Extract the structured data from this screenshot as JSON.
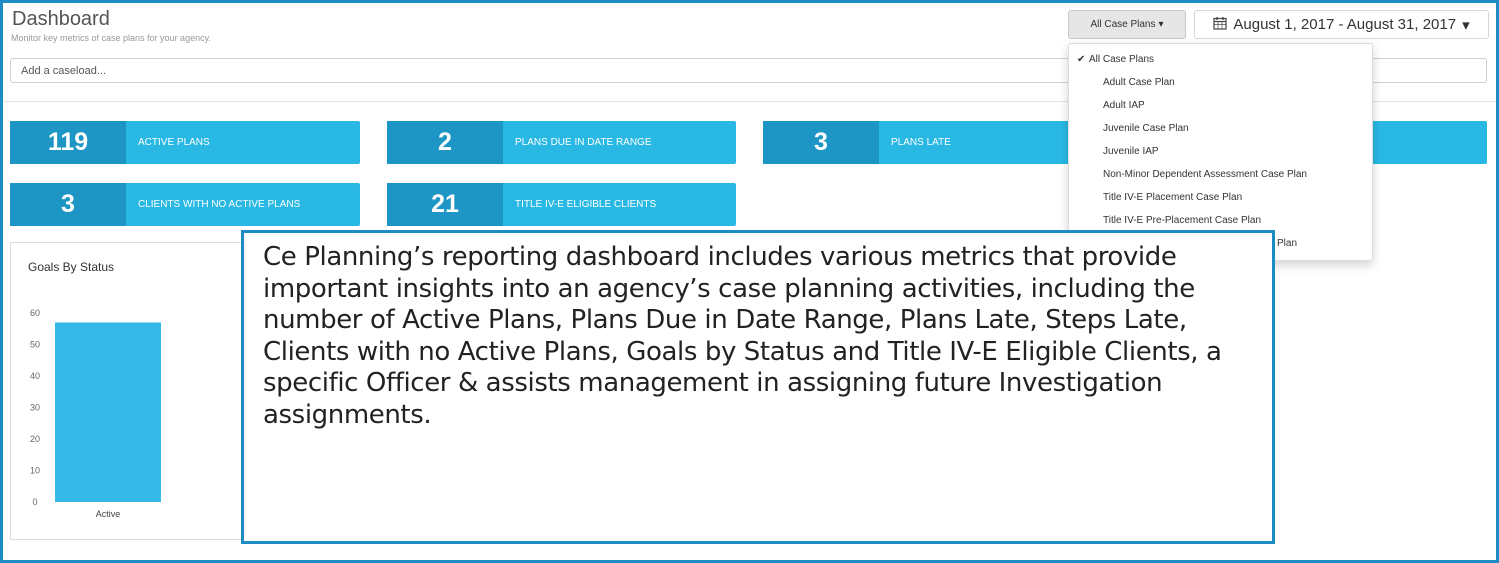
{
  "header": {
    "title": "Dashboard",
    "subtitle": "Monitor key metrics of case plans for your agency."
  },
  "plans_filter": {
    "label": "All Case Plans",
    "caret": "▾"
  },
  "date_range": {
    "label": "August 1, 2017 - August 31, 2017",
    "caret": "▾"
  },
  "caseload": {
    "placeholder": "Add a caseload..."
  },
  "stats": [
    {
      "value": "119",
      "label": "ACTIVE PLANS"
    },
    {
      "value": "2",
      "label": "PLANS DUE IN DATE RANGE"
    },
    {
      "value": "3",
      "label": "PLANS LATE"
    },
    {
      "value": "3",
      "label": "CLIENTS WITH NO ACTIVE PLANS"
    },
    {
      "value": "21",
      "label": "TITLE IV-E ELIGIBLE CLIENTS"
    }
  ],
  "plans_menu": {
    "check": "✔",
    "items": [
      "All Case Plans",
      "Adult Case Plan",
      "Adult IAP",
      "Juvenile Case Plan",
      "Juvenile IAP",
      "Non-Minor Dependent Assessment Case Plan",
      "Title IV-E Placement Case Plan",
      "Title IV-E Pre-Placement Case Plan",
      "Plan"
    ]
  },
  "chart_data": {
    "type": "bar",
    "title": "Goals By Status",
    "categories": [
      "Active"
    ],
    "values": [
      57
    ],
    "ylim": [
      0,
      60
    ],
    "yticks": [
      0,
      10,
      20,
      30,
      40,
      50,
      60
    ],
    "xlabel": "",
    "ylabel": "",
    "bar_color": "#35b9e7",
    "grid": false
  },
  "overlay": {
    "text": "Ce Planning’s reporting dashboard includes various metrics that provide important insights into an agency’s case planning activities, including the number of Active Plans, Plans Due in Date Range, Plans Late, Steps Late, Clients with no Active Plans, Goals by Status and Title IV-E Eligible Clients, a specific Officer & assists management in assigning future Investigation assignments."
  },
  "colors": {
    "accent": "#1e8bc3",
    "stat_bg": "#29b8e4",
    "stat_num_bg": "#1d95c5"
  }
}
